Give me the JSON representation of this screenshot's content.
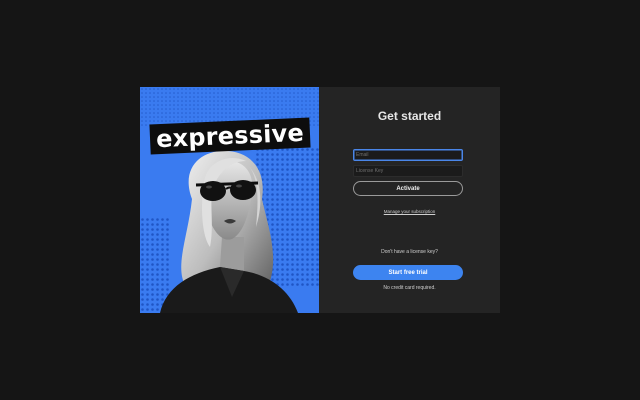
{
  "hero": {
    "brand_text": "expressive",
    "accent_color": "#3a7bf0"
  },
  "panel": {
    "title": "Get started",
    "email": {
      "placeholder": "Email",
      "value": ""
    },
    "license_key": {
      "placeholder": "License Key",
      "value": ""
    },
    "activate_label": "Activate",
    "manage_link": "Manage your subscription",
    "no_key_prompt": "Don't have a license key?",
    "trial_label": "Start free trial",
    "trial_note": "No credit card required.",
    "primary_color": "#3d84f0"
  }
}
